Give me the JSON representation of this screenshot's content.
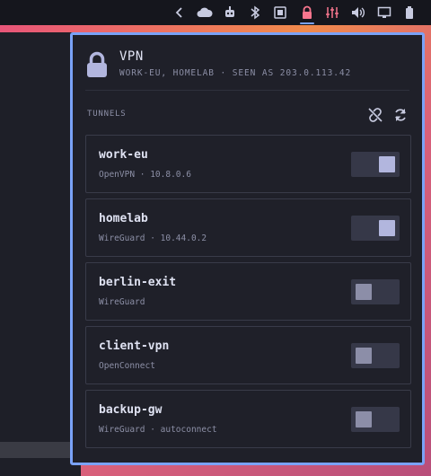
{
  "tray": {
    "icons": [
      "chevron-left-icon",
      "cloud-icon",
      "robot-icon",
      "bluetooth-icon",
      "display-capture-icon",
      "lock-icon",
      "equalizer-icon",
      "volume-icon",
      "monitor-icon",
      "battery-icon"
    ],
    "active": "lock-icon"
  },
  "vpn": {
    "title": "VPN",
    "subtitle": "WORK-EU, HOMELAB · SEEN AS 203.0.113.42",
    "section_label": "TUNNELS",
    "tunnels": [
      {
        "name": "work-eu",
        "meta": "OpenVPN · 10.8.0.6",
        "enabled": true
      },
      {
        "name": "homelab",
        "meta": "WireGuard · 10.44.0.2",
        "enabled": true
      },
      {
        "name": "berlin-exit",
        "meta": "WireGuard",
        "enabled": false
      },
      {
        "name": "client-vpn",
        "meta": "OpenConnect",
        "enabled": false
      },
      {
        "name": "backup-gw",
        "meta": "WireGuard · autoconnect",
        "enabled": false
      }
    ]
  },
  "colors": {
    "accent": "#7aa2f7",
    "lock_active": "#f7768e",
    "panel_bg": "#1f2029"
  }
}
